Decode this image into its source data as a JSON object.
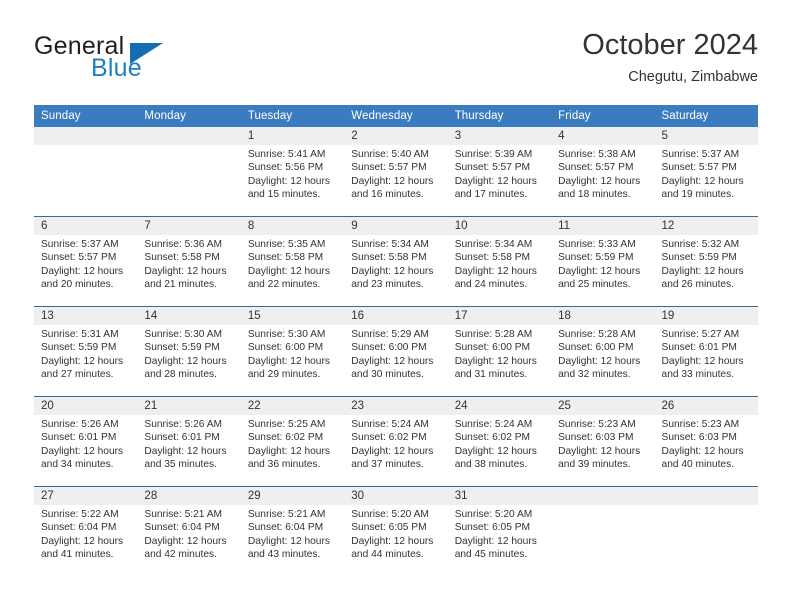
{
  "logo": {
    "word_one": "General",
    "word_two": "Blue",
    "triangle_color": "#156cb0",
    "text_color": "#231f20",
    "blue_color": "#1f7fc4"
  },
  "header": {
    "title": "October 2024",
    "subtitle": "Chegutu, Zimbabwe",
    "header_bg": "#3b7cc0",
    "row_divider": "#2e6da4",
    "daynum_bg": "#efefef"
  },
  "weekday_headers": [
    "Sunday",
    "Monday",
    "Tuesday",
    "Wednesday",
    "Thursday",
    "Friday",
    "Saturday"
  ],
  "weeks": [
    [
      {
        "day": "",
        "sunrise": "",
        "sunset": "",
        "daylight": "",
        "empty": true
      },
      {
        "day": "",
        "sunrise": "",
        "sunset": "",
        "daylight": "",
        "empty": true
      },
      {
        "day": "1",
        "sunrise": "Sunrise: 5:41 AM",
        "sunset": "Sunset: 5:56 PM",
        "daylight": "Daylight: 12 hours and 15 minutes."
      },
      {
        "day": "2",
        "sunrise": "Sunrise: 5:40 AM",
        "sunset": "Sunset: 5:57 PM",
        "daylight": "Daylight: 12 hours and 16 minutes."
      },
      {
        "day": "3",
        "sunrise": "Sunrise: 5:39 AM",
        "sunset": "Sunset: 5:57 PM",
        "daylight": "Daylight: 12 hours and 17 minutes."
      },
      {
        "day": "4",
        "sunrise": "Sunrise: 5:38 AM",
        "sunset": "Sunset: 5:57 PM",
        "daylight": "Daylight: 12 hours and 18 minutes."
      },
      {
        "day": "5",
        "sunrise": "Sunrise: 5:37 AM",
        "sunset": "Sunset: 5:57 PM",
        "daylight": "Daylight: 12 hours and 19 minutes."
      }
    ],
    [
      {
        "day": "6",
        "sunrise": "Sunrise: 5:37 AM",
        "sunset": "Sunset: 5:57 PM",
        "daylight": "Daylight: 12 hours and 20 minutes."
      },
      {
        "day": "7",
        "sunrise": "Sunrise: 5:36 AM",
        "sunset": "Sunset: 5:58 PM",
        "daylight": "Daylight: 12 hours and 21 minutes."
      },
      {
        "day": "8",
        "sunrise": "Sunrise: 5:35 AM",
        "sunset": "Sunset: 5:58 PM",
        "daylight": "Daylight: 12 hours and 22 minutes."
      },
      {
        "day": "9",
        "sunrise": "Sunrise: 5:34 AM",
        "sunset": "Sunset: 5:58 PM",
        "daylight": "Daylight: 12 hours and 23 minutes."
      },
      {
        "day": "10",
        "sunrise": "Sunrise: 5:34 AM",
        "sunset": "Sunset: 5:58 PM",
        "daylight": "Daylight: 12 hours and 24 minutes."
      },
      {
        "day": "11",
        "sunrise": "Sunrise: 5:33 AM",
        "sunset": "Sunset: 5:59 PM",
        "daylight": "Daylight: 12 hours and 25 minutes."
      },
      {
        "day": "12",
        "sunrise": "Sunrise: 5:32 AM",
        "sunset": "Sunset: 5:59 PM",
        "daylight": "Daylight: 12 hours and 26 minutes."
      }
    ],
    [
      {
        "day": "13",
        "sunrise": "Sunrise: 5:31 AM",
        "sunset": "Sunset: 5:59 PM",
        "daylight": "Daylight: 12 hours and 27 minutes."
      },
      {
        "day": "14",
        "sunrise": "Sunrise: 5:30 AM",
        "sunset": "Sunset: 5:59 PM",
        "daylight": "Daylight: 12 hours and 28 minutes."
      },
      {
        "day": "15",
        "sunrise": "Sunrise: 5:30 AM",
        "sunset": "Sunset: 6:00 PM",
        "daylight": "Daylight: 12 hours and 29 minutes."
      },
      {
        "day": "16",
        "sunrise": "Sunrise: 5:29 AM",
        "sunset": "Sunset: 6:00 PM",
        "daylight": "Daylight: 12 hours and 30 minutes."
      },
      {
        "day": "17",
        "sunrise": "Sunrise: 5:28 AM",
        "sunset": "Sunset: 6:00 PM",
        "daylight": "Daylight: 12 hours and 31 minutes."
      },
      {
        "day": "18",
        "sunrise": "Sunrise: 5:28 AM",
        "sunset": "Sunset: 6:00 PM",
        "daylight": "Daylight: 12 hours and 32 minutes."
      },
      {
        "day": "19",
        "sunrise": "Sunrise: 5:27 AM",
        "sunset": "Sunset: 6:01 PM",
        "daylight": "Daylight: 12 hours and 33 minutes."
      }
    ],
    [
      {
        "day": "20",
        "sunrise": "Sunrise: 5:26 AM",
        "sunset": "Sunset: 6:01 PM",
        "daylight": "Daylight: 12 hours and 34 minutes."
      },
      {
        "day": "21",
        "sunrise": "Sunrise: 5:26 AM",
        "sunset": "Sunset: 6:01 PM",
        "daylight": "Daylight: 12 hours and 35 minutes."
      },
      {
        "day": "22",
        "sunrise": "Sunrise: 5:25 AM",
        "sunset": "Sunset: 6:02 PM",
        "daylight": "Daylight: 12 hours and 36 minutes."
      },
      {
        "day": "23",
        "sunrise": "Sunrise: 5:24 AM",
        "sunset": "Sunset: 6:02 PM",
        "daylight": "Daylight: 12 hours and 37 minutes."
      },
      {
        "day": "24",
        "sunrise": "Sunrise: 5:24 AM",
        "sunset": "Sunset: 6:02 PM",
        "daylight": "Daylight: 12 hours and 38 minutes."
      },
      {
        "day": "25",
        "sunrise": "Sunrise: 5:23 AM",
        "sunset": "Sunset: 6:03 PM",
        "daylight": "Daylight: 12 hours and 39 minutes."
      },
      {
        "day": "26",
        "sunrise": "Sunrise: 5:23 AM",
        "sunset": "Sunset: 6:03 PM",
        "daylight": "Daylight: 12 hours and 40 minutes."
      }
    ],
    [
      {
        "day": "27",
        "sunrise": "Sunrise: 5:22 AM",
        "sunset": "Sunset: 6:04 PM",
        "daylight": "Daylight: 12 hours and 41 minutes."
      },
      {
        "day": "28",
        "sunrise": "Sunrise: 5:21 AM",
        "sunset": "Sunset: 6:04 PM",
        "daylight": "Daylight: 12 hours and 42 minutes."
      },
      {
        "day": "29",
        "sunrise": "Sunrise: 5:21 AM",
        "sunset": "Sunset: 6:04 PM",
        "daylight": "Daylight: 12 hours and 43 minutes."
      },
      {
        "day": "30",
        "sunrise": "Sunrise: 5:20 AM",
        "sunset": "Sunset: 6:05 PM",
        "daylight": "Daylight: 12 hours and 44 minutes."
      },
      {
        "day": "31",
        "sunrise": "Sunrise: 5:20 AM",
        "sunset": "Sunset: 6:05 PM",
        "daylight": "Daylight: 12 hours and 45 minutes."
      },
      {
        "day": "",
        "sunrise": "",
        "sunset": "",
        "daylight": "",
        "empty": true
      },
      {
        "day": "",
        "sunrise": "",
        "sunset": "",
        "daylight": "",
        "empty": true
      }
    ]
  ]
}
